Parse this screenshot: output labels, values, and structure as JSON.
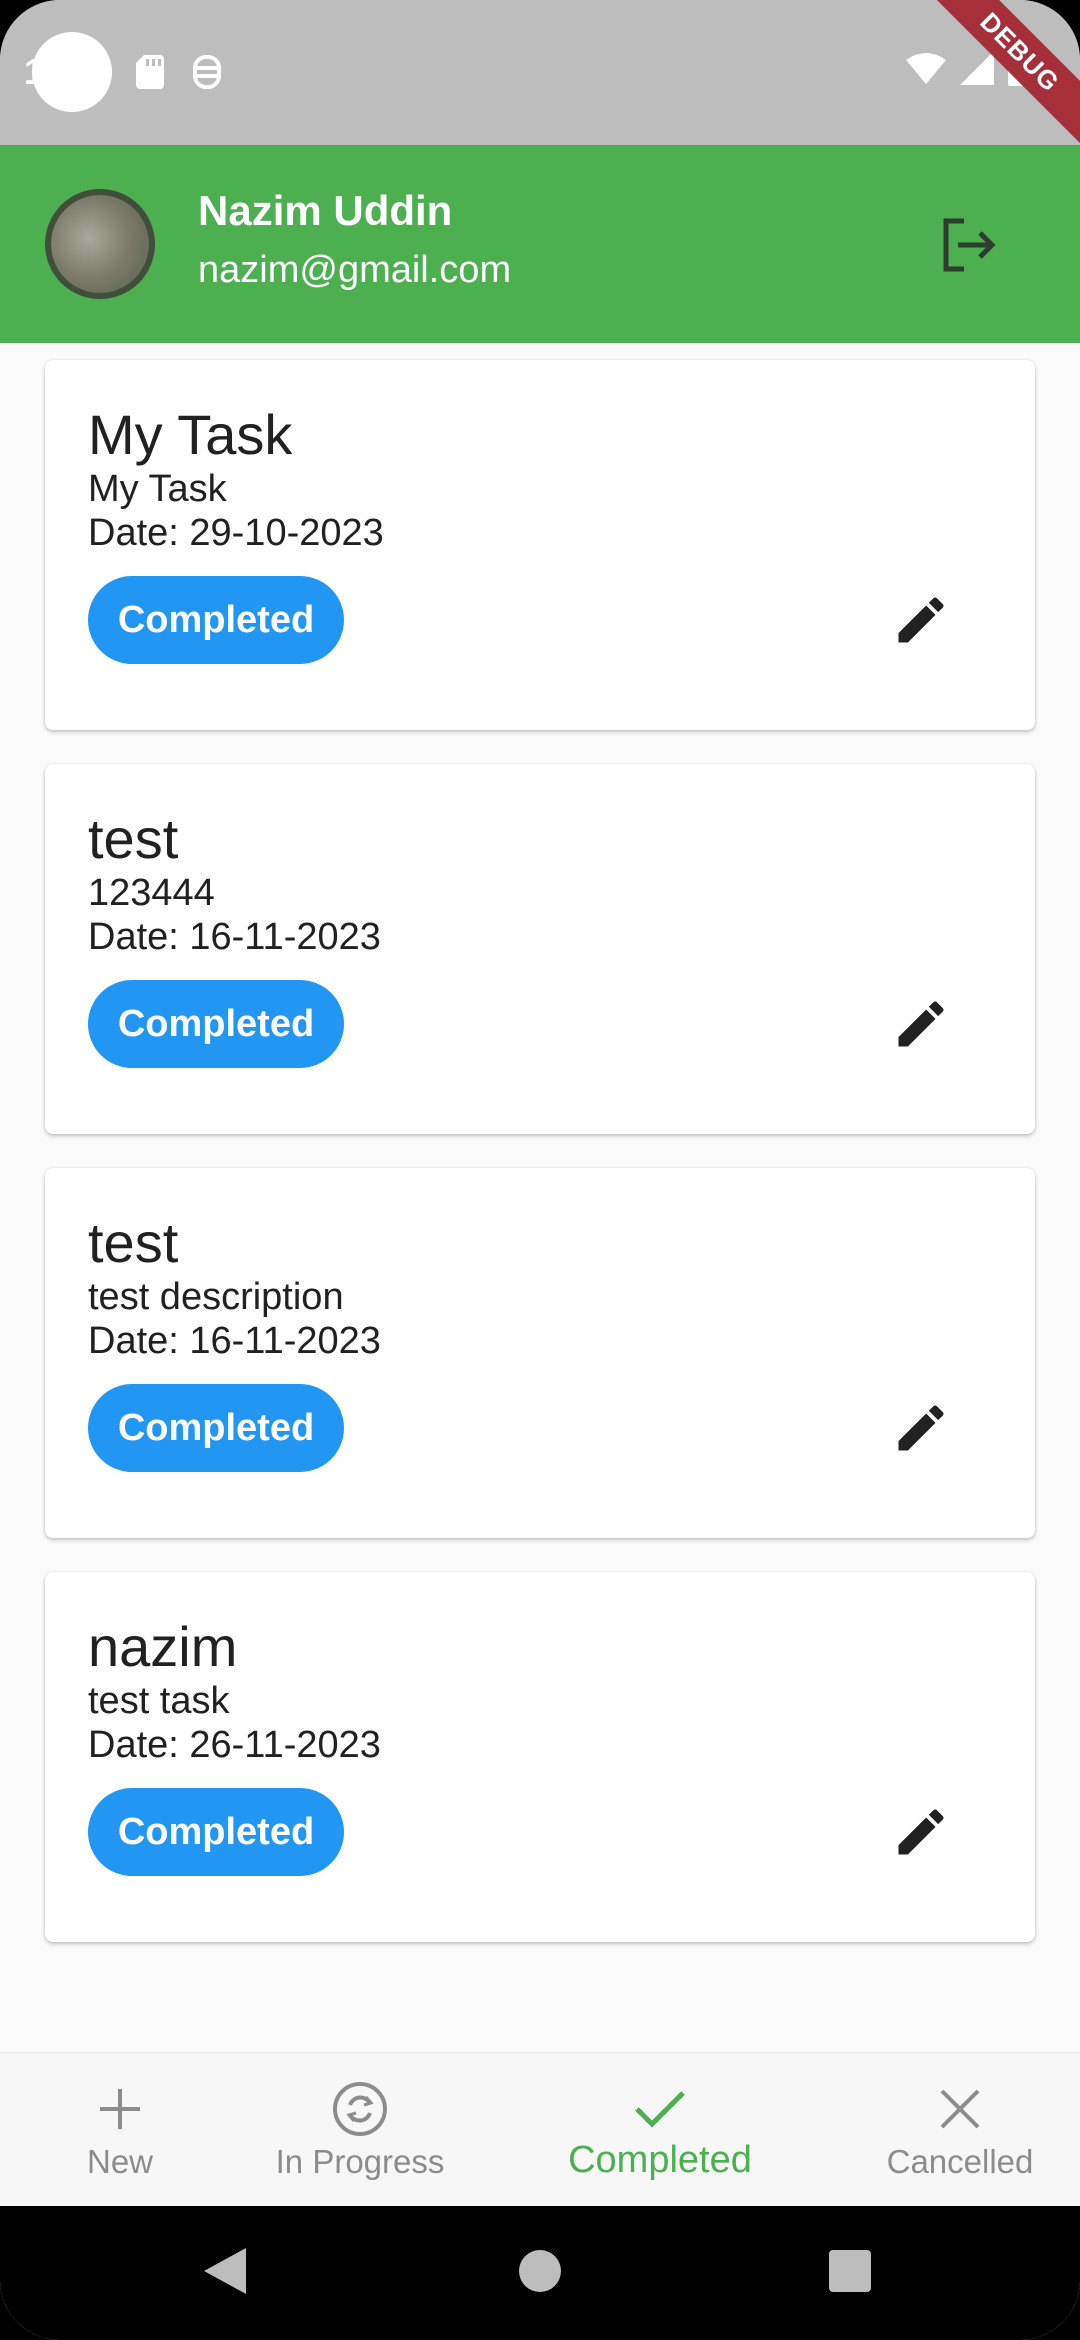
{
  "status_bar": {
    "left_glyph": "1",
    "debug_banner": "DEBUG",
    "icons": [
      "sd-card-icon",
      "vpn-icon",
      "wifi-icon",
      "signal-icon",
      "battery-icon"
    ]
  },
  "header": {
    "user_name": "Nazim Uddin",
    "user_email": "nazim@gmail.com",
    "logout_icon": "logout-icon",
    "background_color": "#4caf50"
  },
  "tasks": [
    {
      "title": "My Task",
      "description": "My Task",
      "date": "Date: 29-10-2023",
      "status": "Completed"
    },
    {
      "title": "test",
      "description": "123444",
      "date": "Date: 16-11-2023",
      "status": "Completed"
    },
    {
      "title": "test",
      "description": "test description",
      "date": "Date: 16-11-2023",
      "status": "Completed"
    },
    {
      "title": "nazim",
      "description": "test task",
      "date": "Date: 26-11-2023",
      "status": "Completed"
    }
  ],
  "bottom_nav": {
    "items": [
      {
        "label": "New",
        "icon": "plus-icon"
      },
      {
        "label": "In Progress",
        "icon": "sync-icon"
      },
      {
        "label": "Completed",
        "icon": "check-icon"
      },
      {
        "label": "Cancelled",
        "icon": "close-icon"
      }
    ],
    "active_index": 2
  },
  "colors": {
    "accent": "#4caf50",
    "chip": "#2196f3",
    "status_bar": "#bdbdbd"
  }
}
